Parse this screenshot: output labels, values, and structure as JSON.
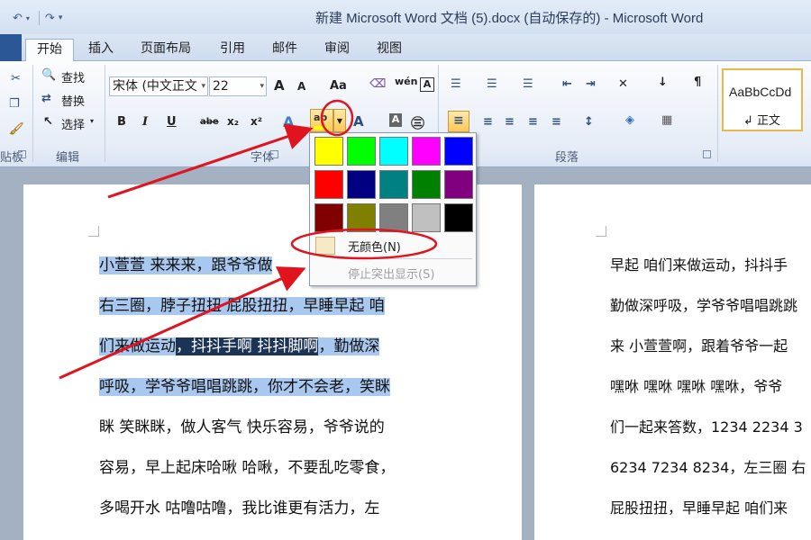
{
  "titlebar": {
    "title": "新建 Microsoft Word 文档 (5).docx (自动保存的) - Microsoft Word",
    "qat_icons": [
      "undo-icon",
      "redo-icon",
      "customize-icon"
    ]
  },
  "tabs": [
    "开始",
    "插入",
    "页面布局",
    "引用",
    "邮件",
    "审阅",
    "视图"
  ],
  "ribbon": {
    "editing": {
      "find": "查找",
      "replace": "替换",
      "select": "选择",
      "group_label": "编辑"
    },
    "font": {
      "font_name": "宋体 (中文正文",
      "font_size": "22",
      "group_label": "字体",
      "bold": "B",
      "italic": "I",
      "underline": "U",
      "strike": "abe",
      "subscript": "x₂",
      "superscript": "x²",
      "grow": "A",
      "shrink": "A",
      "change_case": "Aa",
      "highlight": "ab"
    },
    "paragraph": {
      "group_label": "段落"
    },
    "styles": {
      "sample": "AaBbCcDd",
      "name": "↲ 正文"
    },
    "clipboard_label": "贴板"
  },
  "highlight_menu": {
    "colors": [
      "#ffff00",
      "#00ff00",
      "#00ffff",
      "#ff00ff",
      "#0000ff",
      "#ff0000",
      "#000080",
      "#008080",
      "#008000",
      "#800080",
      "#800000",
      "#808000",
      "#808080",
      "#c0c0c0",
      "#000000"
    ],
    "no_color": "无颜色(N)",
    "stop_highlight": "停止突出显示(S)"
  },
  "document": {
    "page1_lines": [
      [
        {
          "t": "小萱萱  来来来，跟爷爷做",
          "s": "sel"
        }
      ],
      [
        {
          "t": "右三圈，脖子扭扭  屁股扭扭，早睡早起  咱",
          "s": "sel"
        }
      ],
      [
        {
          "t": "们来做运动",
          "s": "sel"
        },
        {
          "t": "，抖抖手啊  抖抖脚啊",
          "s": "selD"
        },
        {
          "t": "，勤做深",
          "s": "sel"
        }
      ],
      [
        {
          "t": "呼吸，学爷爷唱唱跳跳，你才不会老，笑眯",
          "s": "sel"
        }
      ],
      [
        {
          "t": "眯  笑眯眯，做人客气  快乐容易，爷爷说的",
          "s": ""
        }
      ],
      [
        {
          "t": "容易，早上起床哈啾  哈啾，不要乱吃零食，",
          "s": ""
        }
      ],
      [
        {
          "t": "多喝开水  咕噜咕噜，我比谁更有活力，左",
          "s": ""
        }
      ]
    ],
    "page2_lines": [
      "早起  咱们来做运动，抖抖手",
      "勤做深呼吸，学爷爷唱唱跳跳",
      "来  小萱萱啊，跟着爷爷一起",
      "嘿咻  嘿咻  嘿咻  嘿咻，爷爷",
      "们一起来答数，1234  2234  3",
      "6234 7234 8234，左三圈  右",
      "屁股扭扭，早睡早起  咱们来"
    ]
  }
}
